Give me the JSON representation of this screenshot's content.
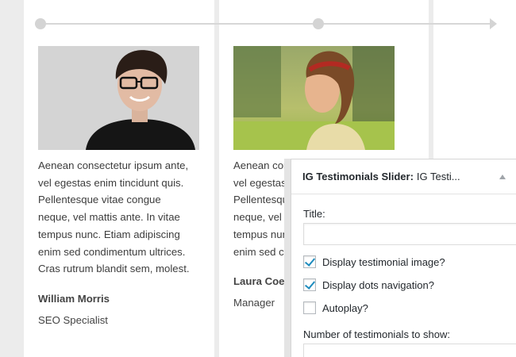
{
  "testimonials": [
    {
      "quote": "Aenean consectetur ipsum ante,\nvel egestas enim tincidunt quis.\nPellentesque vitae congue\nneque, vel mattis ante. In vitae\ntempus nunc. Etiam adipiscing\nenim sed condimentum ultrices.\nCras rutrum blandit sem, molest.",
      "name": "William Morris",
      "role": "SEO Specialist"
    },
    {
      "quote": "Aenean cor\nvel egestas\nPellentesqu\nneque, vel r\ntempus nun\nenim sed co",
      "name": "Laura Coer",
      "role": "Manager"
    }
  ],
  "widget": {
    "title_main": "IG Testimonials Slider:",
    "title_sub": "IG Testi...",
    "title_label": "Title:",
    "title_value": "",
    "options": [
      {
        "label": "Display testimonial image?",
        "checked": true
      },
      {
        "label": "Display dots navigation?",
        "checked": true
      },
      {
        "label": "Autoplay?",
        "checked": false
      }
    ],
    "count_label": "Number of testimonials to show:"
  },
  "colors": {
    "accent_check": "#1e8cbe",
    "timeline": "#d4d4d4"
  }
}
